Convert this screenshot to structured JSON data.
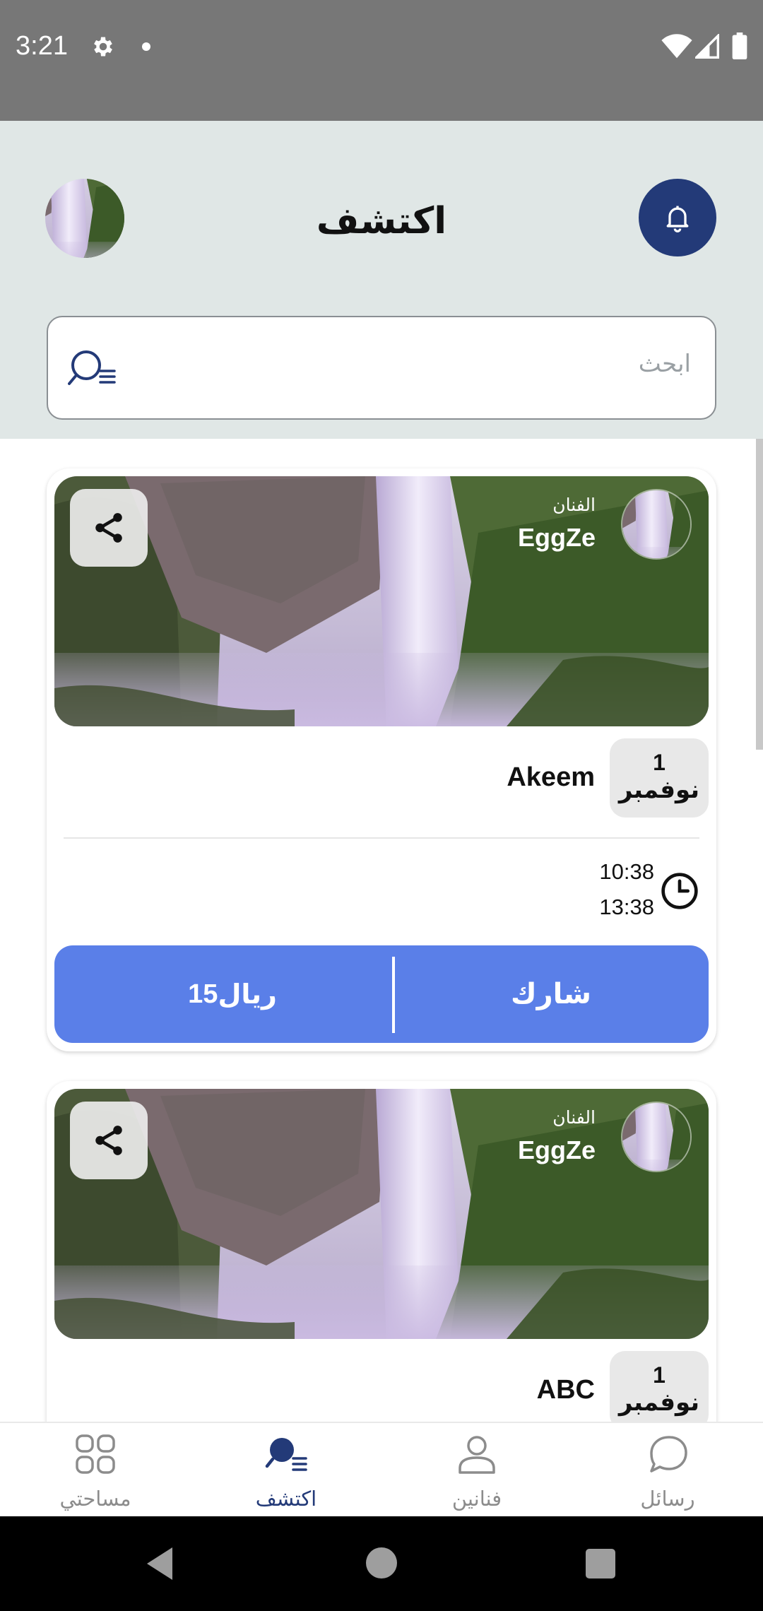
{
  "status_bar": {
    "time": "3:21"
  },
  "header": {
    "title": "اكتشف"
  },
  "search": {
    "placeholder": "ابحث"
  },
  "events": [
    {
      "artist_label": "الفنان",
      "artist_name": "EggZe",
      "date_day": "1",
      "date_month": "نوفمبر",
      "name": "Akeem",
      "time_start": "10:38",
      "time_end": "13:38",
      "join_label": "شارك",
      "price_value": "15",
      "price_currency": "ريال"
    },
    {
      "artist_label": "الفنان",
      "artist_name": "EggZe",
      "date_day": "1",
      "date_month": "نوفمبر",
      "name": "ABC"
    }
  ],
  "bottom_nav": {
    "items": [
      {
        "label": "مساحتي",
        "icon": "grid-icon"
      },
      {
        "label": "اكتشف",
        "icon": "discover-search-icon",
        "active": true
      },
      {
        "label": "فنانين",
        "icon": "person-icon"
      },
      {
        "label": "رسائل",
        "icon": "chat-icon"
      }
    ]
  },
  "colors": {
    "primary": "#233a78",
    "accent": "#5a7fe8",
    "header_bg": "#e0e7e6"
  }
}
